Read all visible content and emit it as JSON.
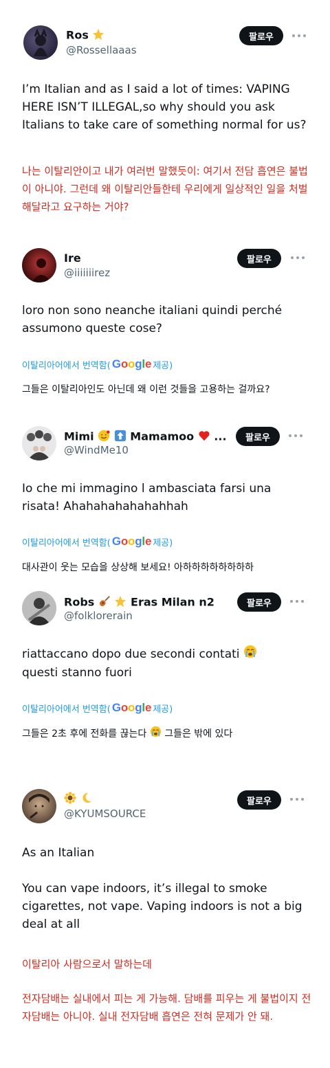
{
  "colors": {
    "follow_bg": "#0f1419",
    "handle": "#536471",
    "korean_red": "#d62a1e",
    "translate_blue": "#1d9bf0"
  },
  "follow_label": "팔로우",
  "translate": {
    "prefix": "이탈리아어에서 번역함(",
    "google": "Google",
    "suffix": " 제공)"
  },
  "posts": [
    {
      "name": "Ros",
      "handle": "@Rossellaaas",
      "text": "I’m Italian and as I said a lot of times: VAPING HERE ISN’T ILLEGAL,so why should you ask Italians to  take care of something normal for us?",
      "korean": "나는 이탈리안이고 내가 여러번 말했듯이: 여기서 전담 흡연은 불법이 아니야. 그런데 왜 이탈리안들한테 우리에게 일상적인 일을 처벌해달라고 요구하는 거야?"
    },
    {
      "name": "Ire",
      "handle": "@iiiiiiirez",
      "text": "loro non sono neanche italiani quindi perché assumono queste cose?",
      "translated": "그들은 이탈리아인도 아닌데 왜 이런 것들을 고용하는 걸까요?"
    },
    {
      "name": "Mimi",
      "name_mid": "Mamamoo",
      "name_suffix": "...",
      "handle": "@WindMe10",
      "text": "Io che mi immagino l ambasciata farsi una risata! Ahahahahahahahhah",
      "translated": "대사관이 웃는 모습을 상상해 보세요! 아하하하하하하하하"
    },
    {
      "name": "Robs",
      "name_suffix": "Eras Milan n2",
      "handle": "@folklorerain",
      "text_line1": "riattaccano dopo due secondi contati",
      "text_line2": "questi stanno fuori",
      "translated_a": "그들은 2초 후에 전화를 끊는다",
      "translated_b": "그들은 밖에 있다"
    },
    {
      "name": "",
      "handle": "@KYUMSOURCE",
      "text_p1": "As an Italian",
      "text_p2": "You can vape indoors, it’s illegal to smoke cigarettes, not vape. Vaping indoors is not a big deal at all",
      "korean_p1": "이탈리아 사람으로서 말하는데",
      "korean_p2": "전자담배는 실내에서 피는 게 가능해. 담배를 피우는 게 불법이지 전자담배는 아니야. 실내 전자담배 흡연은 전혀 문제가 안 돼."
    }
  ]
}
